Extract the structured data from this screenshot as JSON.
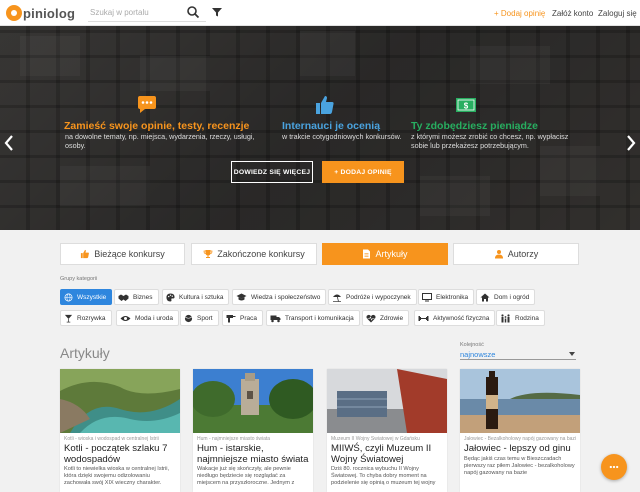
{
  "header": {
    "logo_text": "piniolog",
    "search_placeholder": "Szukaj w portalu",
    "nav": {
      "add_review": "+ Dodaj opinię",
      "register": "Załóż konto",
      "login": "Zaloguj się"
    }
  },
  "hero": {
    "features": [
      {
        "icon": "speech-bubble-icon",
        "title": "Zamieść swoje opinie, testy, recenzje",
        "description": "na dowolne tematy, np. miejsca, wydarzenia, rzeczy, usługi, osoby."
      },
      {
        "icon": "thumbs-up-icon",
        "title": "Internauci je ocenią",
        "description": "w trakcie cotygodniowych konkursów."
      },
      {
        "icon": "money-icon",
        "title": "Ty zdobędziesz pieniądze",
        "description": "z którymi możesz zrobić co chcesz, np. wypłacisz sobie lub przekażesz potrzebującym."
      }
    ],
    "buttons": {
      "learn_more": "DOWIEDZ SIĘ WIĘCEJ",
      "add_review": "+ DODAJ OPINIĘ"
    }
  },
  "tabs": [
    {
      "label": "Bieżące konkursy",
      "icon": "thumbs-up-icon",
      "active": false
    },
    {
      "label": "Zakończone konkursy",
      "icon": "trophy-icon",
      "active": false
    },
    {
      "label": "Artykuły",
      "icon": "document-icon",
      "active": true
    },
    {
      "label": "Autorzy",
      "icon": "user-icon",
      "active": false
    }
  ],
  "groups_label": "Grupy kategorii",
  "categories": [
    {
      "label": "Wszystkie",
      "icon": "globe-icon",
      "active": true
    },
    {
      "label": "Biznes",
      "icon": "handshake-icon",
      "active": false
    },
    {
      "label": "Kultura i sztuka",
      "icon": "palette-icon",
      "active": false
    },
    {
      "label": "Wiedza i społeczeństwo",
      "icon": "graduation-cap-icon",
      "active": false
    },
    {
      "label": "Podróże i wypoczynek",
      "icon": "beach-umbrella-icon",
      "active": false
    },
    {
      "label": "Elektronika",
      "icon": "monitor-icon",
      "active": false
    },
    {
      "label": "Dom i ogród",
      "icon": "house-icon",
      "active": false
    },
    {
      "label": "Rozrywka",
      "icon": "cocktail-icon",
      "active": false
    },
    {
      "label": "Moda i uroda",
      "icon": "eye-icon",
      "active": false
    },
    {
      "label": "Sport",
      "icon": "ball-icon",
      "active": false
    },
    {
      "label": "Praca",
      "icon": "drill-icon",
      "active": false
    },
    {
      "label": "Transport i komunikacja",
      "icon": "truck-icon",
      "active": false
    },
    {
      "label": "Zdrowie",
      "icon": "heartbeat-icon",
      "active": false
    },
    {
      "label": "Aktywność fizyczna",
      "icon": "dumbbell-icon",
      "active": false
    },
    {
      "label": "Rodzina",
      "icon": "family-icon",
      "active": false
    }
  ],
  "articles_title": "Artykuły",
  "sort": {
    "label": "Kolejność",
    "value": "najnowsze"
  },
  "articles": [
    {
      "meta": "Kotli - wioska i wodospad w centralnej Istrii",
      "title": "Kotli - początek szlaku 7 wodospadów",
      "body": "Kotli to niewielka wioska w centralnej Istrii, która dzięki swojemu odizolowaniu zachowała swój XIX wieczny charakter."
    },
    {
      "meta": "Hum - najmniejsze miasto świata",
      "title": "Hum - istarskie, najmniejsze miasto świata",
      "body": "Wakacje już się skończyły, ale pewnie niedługo będziecie się rozglądać za miejscem na przyszłoroczne. Jednym z"
    },
    {
      "meta": "Muzeum II Wojny Światowej w Gdańsku",
      "title": "MIIWŚ, czyli Muzeum II Wojny Światowej",
      "body": "Dziś 80. rocznica wybuchu II Wojny Światowej. To chyba dobry moment na podzielenie się opinią o muzeum tej wojny"
    },
    {
      "meta": "Jałowiec - Bezalkoholowy napój gazowany na bazie",
      "title": "Jałowiec - lepszy od ginu",
      "body": "Będąc jakiś czas temu w Bieszczadach pierwszy raz piłem Jałowiec - bezalkoholowy napój gazowany na bazie"
    }
  ],
  "colors": {
    "accent": "#f7941d",
    "active_chip": "#2e86de"
  }
}
